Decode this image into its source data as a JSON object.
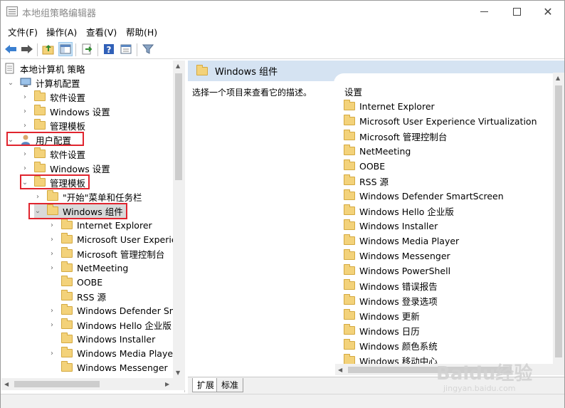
{
  "window": {
    "title": "本地组策略编辑器"
  },
  "menu": {
    "items": [
      "文件(F)",
      "操作(A)",
      "查看(V)",
      "帮助(H)"
    ]
  },
  "toolbar": {
    "icons": [
      "back-arrow-icon",
      "forward-arrow-icon",
      "up-folder-icon",
      "show-hide-tree-icon",
      "export-list-icon",
      "help-icon",
      "properties-icon",
      "filter-icon"
    ]
  },
  "tree": {
    "root": "本地计算机 策略",
    "computer_config": "计算机配置",
    "computer_children": [
      "软件设置",
      "Windows 设置",
      "管理模板"
    ],
    "user_config": "用户配置",
    "user_children": [
      "软件设置",
      "Windows 设置"
    ],
    "admin_templates": "管理模板",
    "start_menu": "\"开始\"菜单和任务栏",
    "windows_components": "Windows 组件",
    "components": [
      {
        "label": "Internet Explorer",
        "expandable": true
      },
      {
        "label": "Microsoft User Experier",
        "expandable": true
      },
      {
        "label": "Microsoft 管理控制台",
        "expandable": true
      },
      {
        "label": "NetMeeting",
        "expandable": true
      },
      {
        "label": "OOBE",
        "expandable": false
      },
      {
        "label": "RSS 源",
        "expandable": false
      },
      {
        "label": "Windows Defender Sma",
        "expandable": true
      },
      {
        "label": "Windows Hello 企业版",
        "expandable": true
      },
      {
        "label": "Windows Installer",
        "expandable": false
      },
      {
        "label": "Windows Media Player",
        "expandable": true
      },
      {
        "label": "Windows Messenger",
        "expandable": false
      }
    ]
  },
  "right": {
    "header": "Windows 组件",
    "description": "选择一个项目来查看它的描述。",
    "column_header": "设置",
    "items": [
      "Internet Explorer",
      "Microsoft User Experience Virtualization",
      "Microsoft 管理控制台",
      "NetMeeting",
      "OOBE",
      "RSS 源",
      "Windows Defender SmartScreen",
      "Windows Hello 企业版",
      "Windows Installer",
      "Windows Media Player",
      "Windows Messenger",
      "Windows PowerShell",
      "Windows 错误报告",
      "Windows 登录选项",
      "Windows 更新",
      "Windows 日历",
      "Windows 颜色系统",
      "Windows 移动中心"
    ]
  },
  "tabs": [
    "扩展",
    "标准"
  ],
  "watermark": {
    "main": "Baidu经验",
    "sub": "jingyan.baidu.com"
  },
  "colors": {
    "highlight_box": "#e0242e",
    "header_bg": "#d5e3f2",
    "folder": "#f3d27a"
  }
}
